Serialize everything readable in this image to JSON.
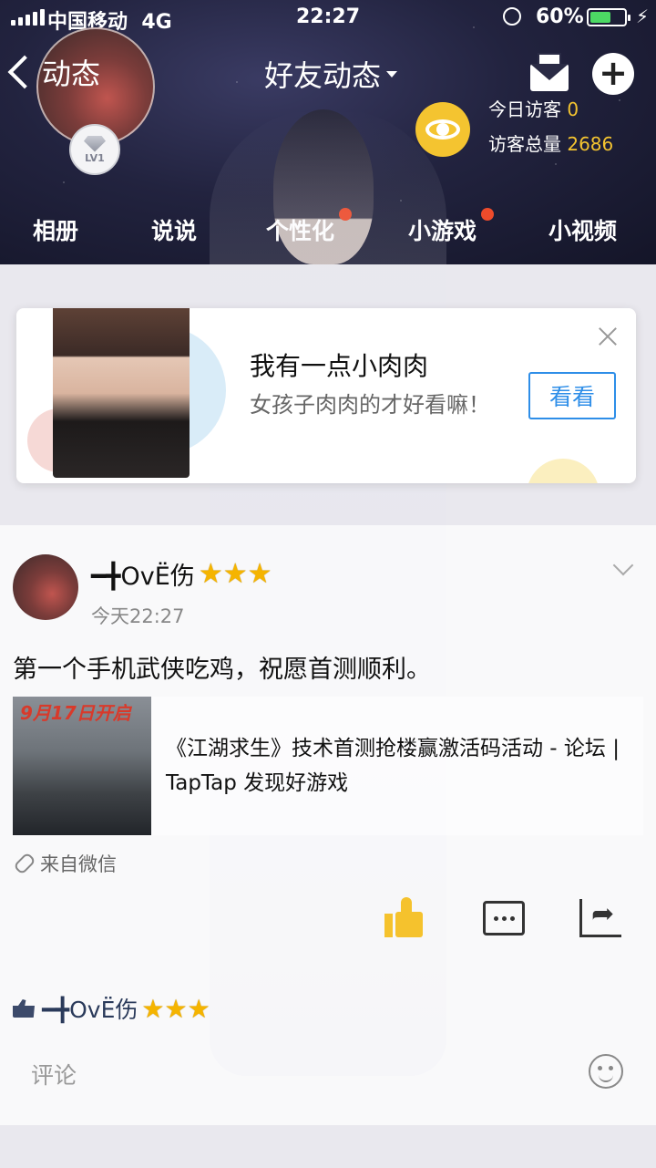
{
  "status_bar": {
    "carrier": "中国移动",
    "network": "4G",
    "time": "22:27",
    "battery_percent": "60%",
    "battery_level": 0.6
  },
  "header": {
    "back_label": "动态",
    "title": "好友动态",
    "level_badge": "LV1",
    "visitors_today_label": "今日访客",
    "visitors_today_value": "0",
    "visitors_total_label": "访客总量",
    "visitors_total_value": "2686"
  },
  "tabs": [
    {
      "label": "相册",
      "has_dot": false
    },
    {
      "label": "说说",
      "has_dot": false
    },
    {
      "label": "个性化",
      "has_dot": true
    },
    {
      "label": "小游戏",
      "has_dot": true
    },
    {
      "label": "小视频",
      "has_dot": false
    }
  ],
  "ad": {
    "title": "我有一点小肉肉",
    "subtitle": "女孩子肉肉的才好看嘛！",
    "cta": "看看"
  },
  "post": {
    "username": "━╋OvË伤",
    "stars": "⭐⭐⭐",
    "time": "今天22:27",
    "text": "第一个手机武侠吃鸡，祝愿首测顺利。",
    "link_thumb_text": "9月17日开启",
    "link_title": "《江湖求生》技术首测抢楼赢激活码活动 - 论坛 | TapTap 发现好游戏",
    "source": "来自微信",
    "liked_by": "━╋OvË伤",
    "comment_placeholder": "评论"
  },
  "colors": {
    "accent_yellow": "#f4c430",
    "cta_blue": "#2e8ee8",
    "badge_red": "#ee4b2b"
  }
}
